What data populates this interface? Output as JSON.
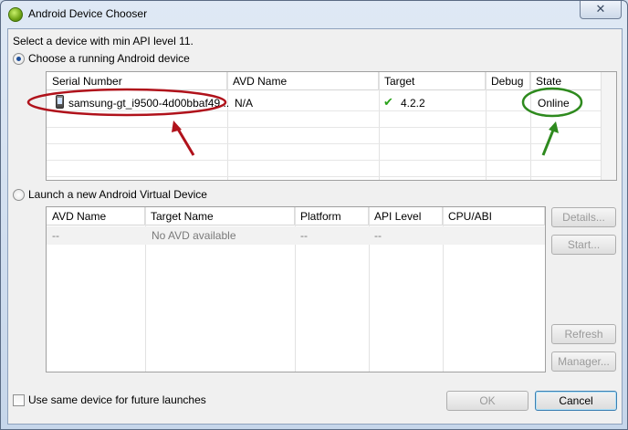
{
  "window": {
    "title": "Android Device Chooser",
    "close_glyph": "✕"
  },
  "prompt": "Select a device with min API level 11.",
  "running": {
    "radio_label": "Choose a running Android device",
    "columns": [
      "Serial Number",
      "AVD Name",
      "Target",
      "Debug",
      "State"
    ],
    "rows": [
      {
        "serial": "samsung-gt_i9500-4d00bbaf49...",
        "avd_name": "N/A",
        "target": "4.2.2",
        "debug": "",
        "state": "Online"
      }
    ],
    "selected": true
  },
  "launch": {
    "radio_label": "Launch a new Android Virtual Device",
    "columns": [
      "AVD Name",
      "Target Name",
      "Platform",
      "API Level",
      "CPU/ABI"
    ],
    "rows": [
      {
        "avd_name": "--",
        "target_name": "No AVD available",
        "platform": "--",
        "api_level": "--",
        "cpu_abi": ""
      }
    ],
    "buttons": {
      "details": "Details...",
      "start": "Start...",
      "refresh": "Refresh",
      "manager": "Manager..."
    }
  },
  "footer": {
    "checkbox_label": "Use same device for future launches",
    "checkbox_checked": false,
    "ok": "OK",
    "cancel": "Cancel"
  },
  "colors": {
    "annotation_red": "#b0121b",
    "annotation_green": "#2e8a1e",
    "accent": "#3c7fb1"
  },
  "icons": {
    "device": "phone-icon",
    "target_ok": "check-icon",
    "app": "android-icon"
  }
}
